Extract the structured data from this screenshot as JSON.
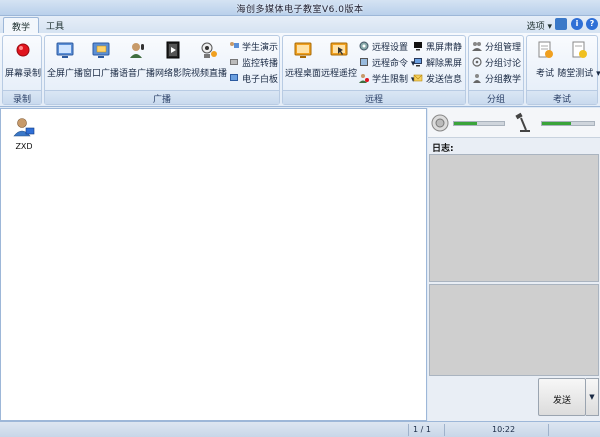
{
  "window": {
    "title": "海创多媒体电子教室V6.0版本"
  },
  "tabs": [
    {
      "label": "教学",
      "active": true
    },
    {
      "label": "工具",
      "active": false
    }
  ],
  "options_label": "选项",
  "ribbon": {
    "record": {
      "label": "录制",
      "buttons": [
        {
          "label": "屏幕录制",
          "icon": "record-icon"
        }
      ]
    },
    "broadcast": {
      "label": "广播",
      "buttons": [
        {
          "label": "全屏广播",
          "icon": "fullscreen-broadcast-icon"
        },
        {
          "label": "窗口广播",
          "icon": "window-broadcast-icon"
        },
        {
          "label": "语音广播",
          "icon": "voice-broadcast-icon"
        },
        {
          "label": "网络影院",
          "icon": "network-cinema-icon"
        },
        {
          "label": "视频直播",
          "icon": "video-live-icon"
        }
      ],
      "small": [
        {
          "label": "学生演示",
          "icon": "student-demo-icon"
        },
        {
          "label": "监控转播",
          "icon": "monitor-relay-icon"
        },
        {
          "label": "电子白板",
          "icon": "whiteboard-icon"
        }
      ]
    },
    "remote": {
      "label": "远程",
      "buttons": [
        {
          "label": "远程桌面",
          "icon": "remote-desktop-icon"
        },
        {
          "label": "远程遥控",
          "icon": "remote-control-icon"
        }
      ],
      "small": [
        {
          "label": "远程设置",
          "icon": "remote-settings-icon"
        },
        {
          "label": "远程命令",
          "icon": "remote-command-icon"
        },
        {
          "label": "学生限制",
          "icon": "student-restrict-icon"
        },
        {
          "label": "黑屏肃静",
          "icon": "black-screen-icon"
        },
        {
          "label": "解除黑屏",
          "icon": "unblack-screen-icon"
        },
        {
          "label": "发送信息",
          "icon": "send-message-icon"
        }
      ]
    },
    "grouping": {
      "label": "分组",
      "small": [
        {
          "label": "分组管理",
          "icon": "group-manage-icon"
        },
        {
          "label": "分组讨论",
          "icon": "group-discuss-icon"
        },
        {
          "label": "分组教学",
          "icon": "group-teach-icon"
        }
      ]
    },
    "exam": {
      "label": "考试",
      "buttons": [
        {
          "label": "考试",
          "icon": "exam-icon"
        },
        {
          "label": "随堂测试",
          "icon": "quiz-icon"
        }
      ]
    }
  },
  "students": [
    {
      "name": "ZXD"
    }
  ],
  "right_panel": {
    "log_label": "日志:",
    "speaker_level": 0.45,
    "mic_level": 0.55,
    "send_label": "发送"
  },
  "status": {
    "pages": "1 / 1",
    "time": "10:22"
  },
  "colors": {
    "accent": "#2f6fd6",
    "record": "#e0141e",
    "level": "#3aa43a"
  }
}
